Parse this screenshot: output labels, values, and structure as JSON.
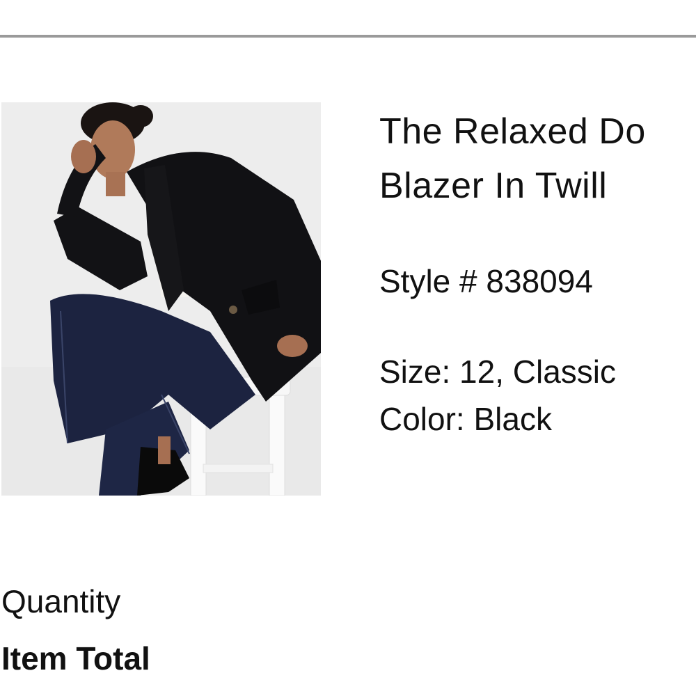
{
  "product": {
    "image_alt": "Model wearing The Relaxed Double Breasted Blazer In Twill",
    "title_line1": "The Relaxed Do",
    "title_line2": "Blazer In Twill",
    "style_number": "Style # 838094",
    "size": "Size: 12, Classic",
    "color": "Color: Black"
  },
  "summary": {
    "quantity_label": "Quantity",
    "item_total_label": "Item Total"
  }
}
